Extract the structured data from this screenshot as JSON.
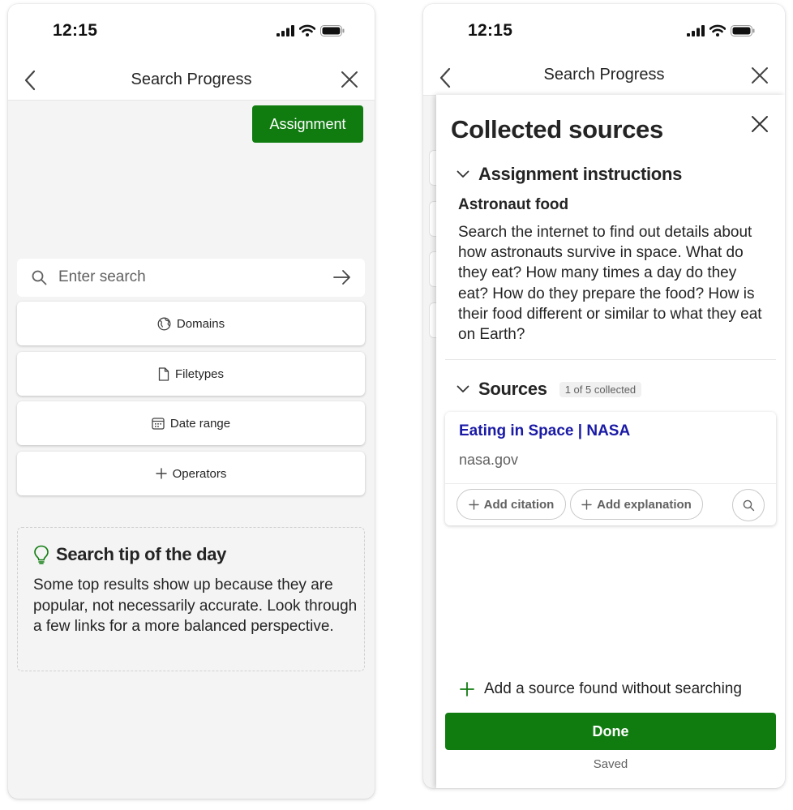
{
  "left_screen": {
    "status": {
      "time": "12:15"
    },
    "nav": {
      "title": "Search Progress"
    },
    "assignment_button": "Assignment",
    "search": {
      "placeholder": "Enter search"
    },
    "filters": [
      "Domains",
      "Filetypes",
      "Date range",
      "Operators"
    ],
    "tip": {
      "title": "Search tip of the day",
      "body": "Some top results show up because they are popular, not necessarily accurate. Look through a few links for a more balanced perspective."
    }
  },
  "right_screen": {
    "status": {
      "time": "12:15"
    },
    "nav": {
      "title": "Search Progress"
    },
    "panel": {
      "title": "Collected sources",
      "assignment_section": {
        "heading": "Assignment instructions",
        "topic": "Astronaut food",
        "text": "Search the internet to find out details about how astronauts survive in space. What do they eat? How many times a day do they eat? How do they prepare the food? How is their food different or similar to what they eat on Earth?"
      },
      "sources_section": {
        "heading": "Sources",
        "badge": "1 of 5 collected",
        "items": [
          {
            "title": "Eating in Space | NASA",
            "domain": "nasa.gov"
          }
        ],
        "add_citation": "Add citation",
        "add_explanation": "Add explanation"
      },
      "add_source": "Add a source found without searching",
      "done": "Done",
      "saved": "Saved"
    }
  },
  "colors": {
    "primary_green": "#107c10",
    "link": "#1a1aa6",
    "tip_icon": "#107c10"
  }
}
